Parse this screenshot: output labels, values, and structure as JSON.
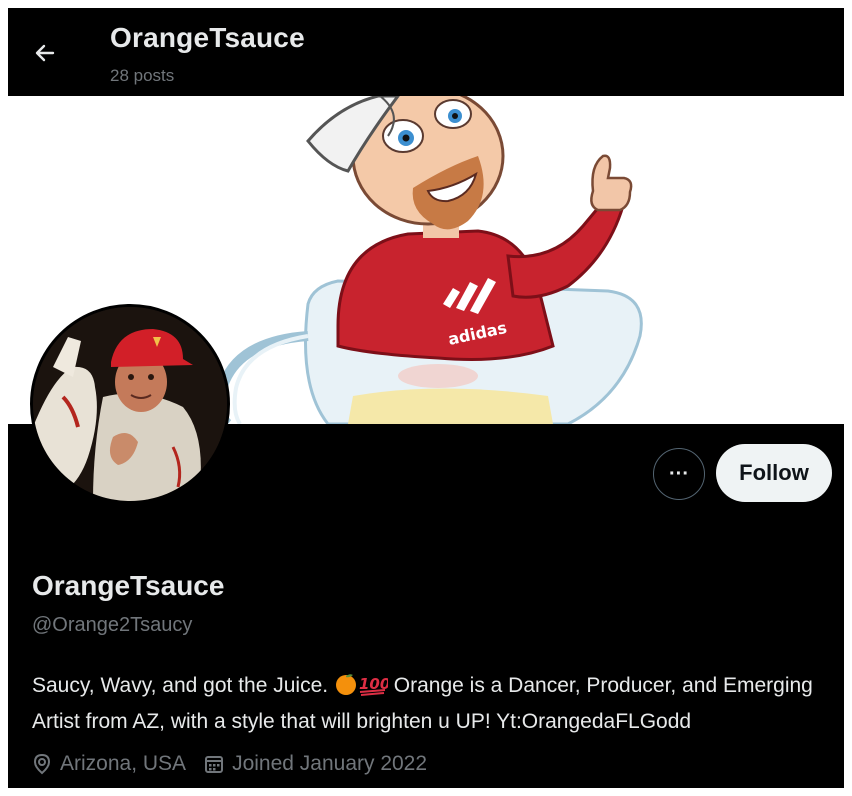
{
  "header": {
    "title": "OrangeTsauce",
    "posts_count": "28 posts",
    "back_icon": "arrow-left-icon"
  },
  "profile": {
    "display_name": "OrangeTsauce",
    "handle": "@Orange2Tsaucy",
    "bio_part1": "Saucy, Wavy, and got the Juice.",
    "bio_emoji": [
      "orange-emoji",
      "hundred-points-emoji"
    ],
    "bio_part2": "Orange is a Dancer, Producer, and Emerging Artist from AZ, with a style that will brighten u UP! Yt:OrangedaFLGodd",
    "location": "Arizona, USA",
    "joined": "Joined January 2022"
  },
  "actions": {
    "more_label": "···",
    "follow_label": "Follow"
  },
  "colors": {
    "background": "#000000",
    "text_primary": "#e7e9ea",
    "text_secondary": "#71767b",
    "follow_bg": "#eff3f4"
  }
}
